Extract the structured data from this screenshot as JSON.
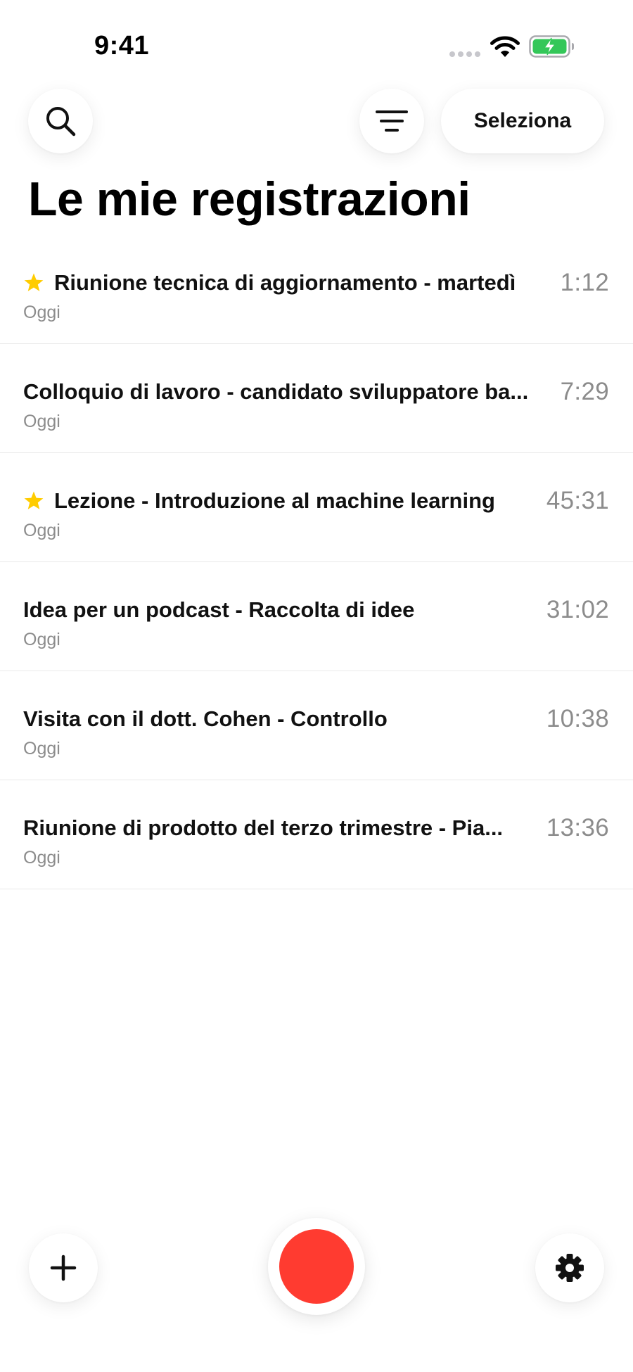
{
  "status_bar": {
    "time": "9:41",
    "icons": [
      "signal-dots-icon",
      "wifi-icon",
      "battery-charging-icon"
    ],
    "battery_color": "#34c759"
  },
  "toolbar": {
    "search_icon": "search-icon",
    "filter_icon": "filter-icon",
    "select_label": "Seleziona"
  },
  "page": {
    "title": "Le mie registrazioni"
  },
  "recordings": [
    {
      "title": "Riunione tecnica di aggiornamento - martedì",
      "date": "Oggi",
      "duration": "1:12",
      "starred": true
    },
    {
      "title": "Colloquio di lavoro - candidato sviluppatore ba...",
      "date": "Oggi",
      "duration": "7:29",
      "starred": false
    },
    {
      "title": "Lezione - Introduzione al machine learning",
      "date": "Oggi",
      "duration": "45:31",
      "starred": true
    },
    {
      "title": "Idea per un podcast - Raccolta di idee",
      "date": "Oggi",
      "duration": "31:02",
      "starred": false
    },
    {
      "title": "Visita con il dott. Cohen - Controllo",
      "date": "Oggi",
      "duration": "10:38",
      "starred": false
    },
    {
      "title": "Riunione di prodotto del terzo trimestre - Pia...",
      "date": "Oggi",
      "duration": "13:36",
      "starred": false
    }
  ],
  "bottom_bar": {
    "add_icon": "plus-icon",
    "record_icon": "record-icon",
    "settings_icon": "gear-icon"
  },
  "colors": {
    "record": "#ff3b30",
    "star": "#ffcc00",
    "secondary_text": "#8c8c8c"
  }
}
